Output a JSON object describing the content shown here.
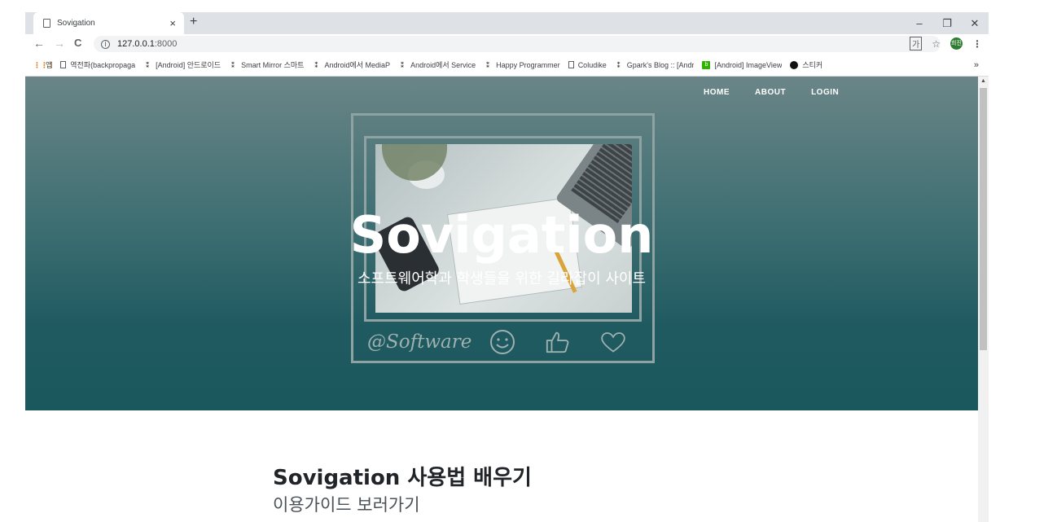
{
  "browser": {
    "tab_title": "Sovigation",
    "tab_close": "×",
    "new_tab": "+",
    "window": {
      "minimize": "–",
      "restore": "❐",
      "close": "✕"
    },
    "nav": {
      "back": "←",
      "forward": "→",
      "reload": "C"
    },
    "url_host": "127.0.0.1",
    "url_port": ":8000",
    "avatar_text": "희진",
    "menu": "⋮"
  },
  "bookmarks": [
    {
      "label": "앱",
      "icon": "apps-grid-icon"
    },
    {
      "label": "역전파(backpropaga",
      "icon": "page-icon"
    },
    {
      "label": "[Android] 안드로이드",
      "icon": "tistory-icon"
    },
    {
      "label": "Smart Mirror 스마트",
      "icon": "tistory-icon"
    },
    {
      "label": "Android에서 MediaP",
      "icon": "tistory-icon"
    },
    {
      "label": "Android에서 Service",
      "icon": "tistory-icon"
    },
    {
      "label": "Happy Programmer",
      "icon": "tistory-icon"
    },
    {
      "label": "Coludike",
      "icon": "page-icon"
    },
    {
      "label": "Gpark's Blog :: [Andr",
      "icon": "tistory-icon"
    },
    {
      "label": "[Android] ImageView",
      "icon": "naver-blog-icon"
    },
    {
      "label": "스티커",
      "icon": "github-icon"
    }
  ],
  "bookmarks_more": "»",
  "site": {
    "nav": [
      "HOME",
      "ABOUT",
      "LOGIN"
    ],
    "hero_title": "Sovigation",
    "hero_subtitle": "소프트웨어학과 학생들을 위한 길라잡이 사이트",
    "frame_caption": "@Software",
    "section_title": "Sovigation 사용법 배우기",
    "section_subtitle": "이용가이드 보러가기"
  },
  "colors": {
    "hero_top": "#6a8587",
    "hero_bottom": "#1a585d",
    "frame": "#8fa3a3"
  }
}
